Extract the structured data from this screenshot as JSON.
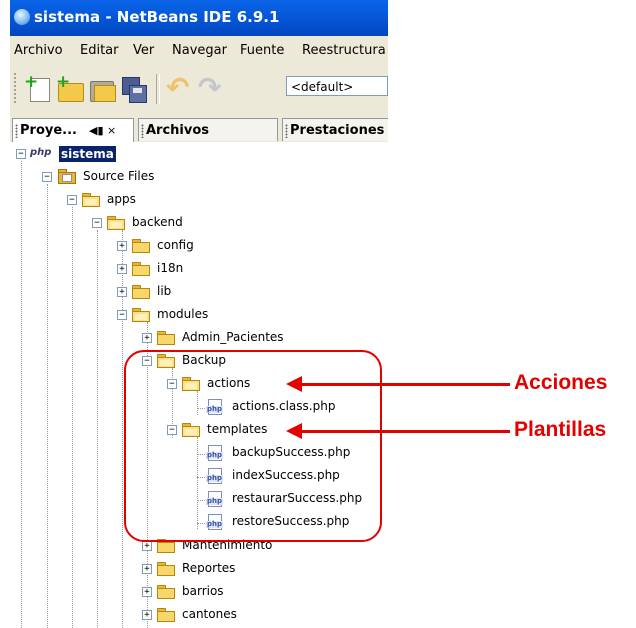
{
  "window": {
    "title": "sistema - NetBeans IDE 6.9.1"
  },
  "menu": [
    "Archivo",
    "Editar",
    "Ver",
    "Navegar",
    "Fuente",
    "Reestructura"
  ],
  "toolbar": {
    "config_value": "<default>"
  },
  "tabs": [
    {
      "label": "Proye...",
      "active": true,
      "controls": "◀▮ ×"
    },
    {
      "label": "Archivos",
      "active": false
    },
    {
      "label": "Prestaciones",
      "active": false
    }
  ],
  "tree": {
    "project": "sistema",
    "project_icon_text": "php",
    "source_files": "Source Files",
    "apps": "apps",
    "backend": "backend",
    "config": "config",
    "i18n": "i18n",
    "lib": "lib",
    "modules": "modules",
    "admin_pacientes": "Admin_Pacientes",
    "backup": "Backup",
    "actions": "actions",
    "actions_class": "actions.class.php",
    "templates": "templates",
    "backup_success": "backupSuccess.php",
    "index_success": "indexSuccess.php",
    "restaurar_success": "restaurarSuccess.php",
    "restore_success": "restoreSuccess.php",
    "mantenimiento": "Mantenimiento",
    "reportes": "Reportes",
    "barrios": "barrios",
    "cantones": "cantones",
    "php_icon_text": "php"
  },
  "annotations": {
    "acciones": "Acciones",
    "plantillas": "Plantillas"
  },
  "colors": {
    "annotation": "#e50000",
    "selection": "#0a246a",
    "titlebar": "#0454d3"
  }
}
